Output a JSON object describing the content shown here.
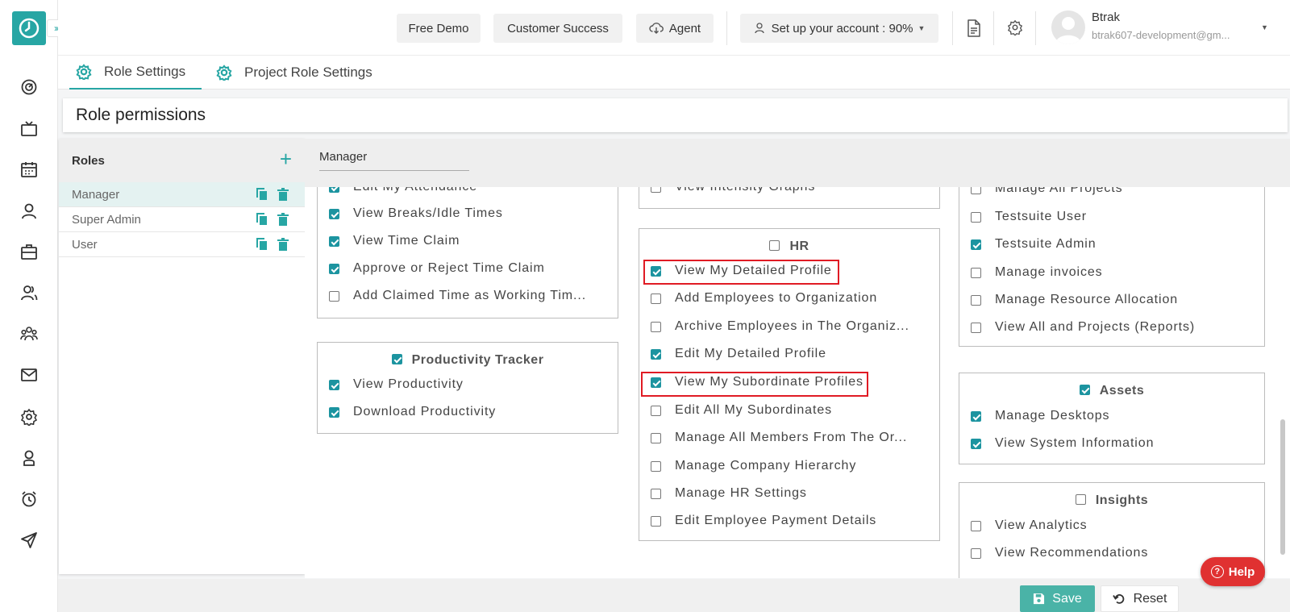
{
  "topbar": {
    "free_demo": "Free Demo",
    "customer_success": "Customer Success",
    "agent": "Agent",
    "setup": "Set up your account : 90%",
    "user_name": "Btrak",
    "user_email": "btrak607-development@gm..."
  },
  "tabs": {
    "role_settings": "Role Settings",
    "project_role_settings": "Project Role Settings"
  },
  "title": "Role permissions",
  "roles": {
    "header": "Roles",
    "items": [
      {
        "label": "Manager"
      },
      {
        "label": "Super Admin"
      },
      {
        "label": "User"
      }
    ]
  },
  "permissions": {
    "role_name": "Manager",
    "col1_top": [
      "Edit My Attendance",
      "View Breaks/Idle Times",
      "View Time Claim",
      "Approve or Reject Time Claim",
      "Add Claimed Time as Working Tim..."
    ],
    "productivity": {
      "title": "Productivity Tracker",
      "items": [
        "View Productivity",
        "Download Productivity"
      ]
    },
    "col2_top": [
      "View Intensity Graphs"
    ],
    "hr": {
      "title": "HR",
      "items": [
        "View My Detailed Profile",
        "Add Employees to Organization",
        "Archive Employees in The Organiz...",
        "Edit My Detailed Profile",
        "View My Subordinate Profiles",
        "Edit All My Subordinates",
        "Manage All Members From The Or...",
        "Manage Company Hierarchy",
        "Manage HR Settings",
        "Edit Employee Payment Details"
      ]
    },
    "col3_top": [
      "Manage All Projects",
      "Testsuite User",
      "Testsuite Admin",
      "Manage invoices",
      "Manage Resource Allocation",
      "View All and Projects (Reports)"
    ],
    "assets": {
      "title": "Assets",
      "items": [
        "Manage Desktops",
        "View System Information"
      ]
    },
    "insights": {
      "title": "Insights",
      "items": [
        "View Analytics",
        "View Recommendations"
      ]
    },
    "checked": {
      "col1_top": [
        true,
        true,
        true,
        true,
        false
      ],
      "productivity_title": true,
      "productivity": [
        true,
        true
      ],
      "col2_top": [
        false
      ],
      "hr_title": false,
      "hr": [
        true,
        false,
        false,
        true,
        true,
        false,
        false,
        false,
        false,
        false
      ],
      "col3_top": [
        false,
        false,
        true,
        false,
        false,
        false
      ],
      "assets_title": true,
      "assets": [
        true,
        true
      ],
      "insights_title": false,
      "insights": [
        false,
        false
      ]
    }
  },
  "buttons": {
    "save": "Save",
    "reset": "Reset",
    "help": "Help"
  },
  "colors": {
    "accent": "#27a6a4",
    "checkbox": "#1c94a0",
    "highlight": "#e01b24",
    "help": "#e03131"
  }
}
